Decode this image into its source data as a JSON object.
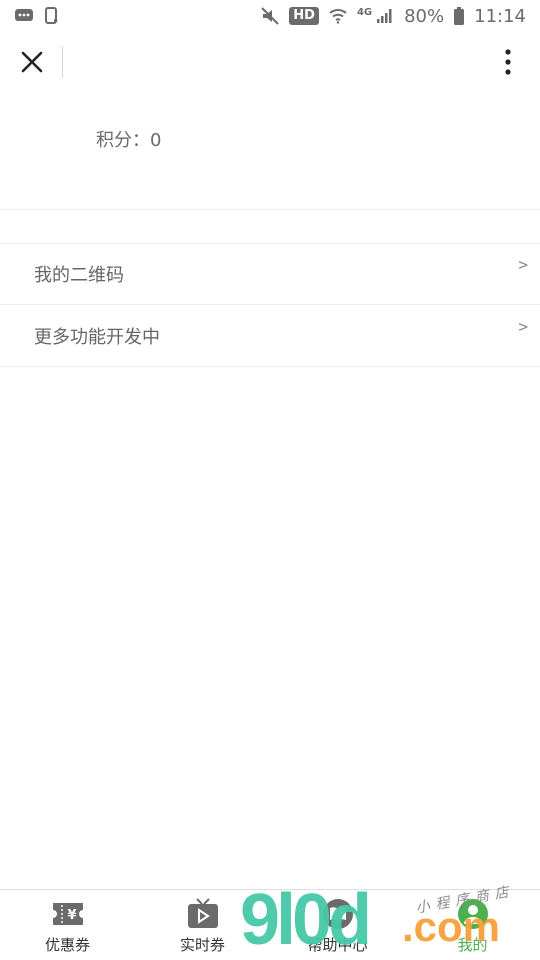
{
  "status_bar": {
    "network": "HD",
    "signal_type": "4G",
    "battery": "80%",
    "time": "11:14"
  },
  "header": {
    "close_icon": "close-icon",
    "more_icon": "more-vertical-icon"
  },
  "points": {
    "label": "积分：0"
  },
  "menu": {
    "items": [
      {
        "label": "我的二维码",
        "arrow": ">"
      },
      {
        "label": "更多功能开发中",
        "arrow": ">"
      }
    ]
  },
  "tabbar": {
    "tabs": [
      {
        "label": "优惠券",
        "icon": "coupon-icon"
      },
      {
        "label": "实时券",
        "icon": "tv-play-icon"
      },
      {
        "label": "帮助中心",
        "icon": "book-icon"
      },
      {
        "label": "我的",
        "icon": "user-icon"
      }
    ],
    "active_color": "#4caf50"
  },
  "watermark": {
    "number": "9l0d",
    "domain": ".com",
    "shop": "小程序商店"
  }
}
